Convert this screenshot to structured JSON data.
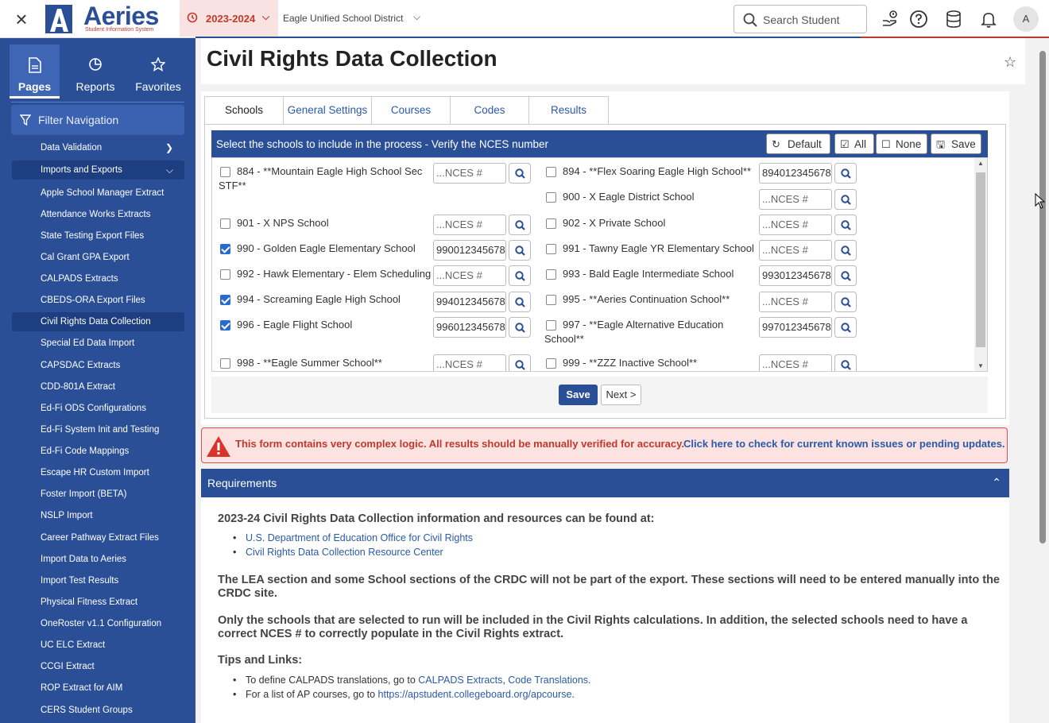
{
  "app": {
    "logo_text": "Aeries",
    "logo_subtitle": "Student Information System",
    "year": "2023-2024",
    "district": "Eagle Unified School District",
    "search_placeholder": "Search Student",
    "avatar_letter": "A"
  },
  "nav": {
    "tabs": [
      {
        "label": "Pages",
        "icon": "file-icon"
      },
      {
        "label": "Reports",
        "icon": "pie-chart-icon"
      },
      {
        "label": "Favorites",
        "icon": "star-icon"
      }
    ],
    "filter_label": "Filter Navigation",
    "items": [
      {
        "label": "Data Validation",
        "type": "group-collapsed"
      },
      {
        "label": "Imports and Exports",
        "type": "group-expanded"
      },
      {
        "label": "Apple School Manager Extract"
      },
      {
        "label": "Attendance Works Extracts"
      },
      {
        "label": "State Testing Export Files"
      },
      {
        "label": "Cal Grant GPA Export"
      },
      {
        "label": "CALPADS Extracts"
      },
      {
        "label": "CBEDS-ORA Export Files"
      },
      {
        "label": "Civil Rights Data Collection",
        "active": true
      },
      {
        "label": "Special Ed Data Import"
      },
      {
        "label": "CAPSDAC Extracts"
      },
      {
        "label": "CDD-801A Extract"
      },
      {
        "label": "Ed-Fi ODS Configurations"
      },
      {
        "label": "Ed-Fi System Init and Testing"
      },
      {
        "label": "Ed-Fi Code Mappings"
      },
      {
        "label": "Escape HR Custom Import"
      },
      {
        "label": "Foster Import (BETA)"
      },
      {
        "label": "NSLP Import"
      },
      {
        "label": "Career Pathway Extract Files"
      },
      {
        "label": "Import Data to Aeries"
      },
      {
        "label": "Import Test Results"
      },
      {
        "label": "Physical Fitness Extract"
      },
      {
        "label": "OneRoster v1.1 Configuration"
      },
      {
        "label": "UC ELC Extract"
      },
      {
        "label": "CCGI Extract"
      },
      {
        "label": "ROP Extract for AIM"
      },
      {
        "label": "CERS Student Groups"
      }
    ]
  },
  "page": {
    "title": "Civil Rights Data Collection",
    "tabs": [
      "Schools",
      "General Settings",
      "Courses",
      "Codes",
      "Results"
    ],
    "select_header": "Select the schools to include in the process - Verify the NCES number",
    "header_buttons": {
      "default": "Default",
      "all": "All",
      "none": "None",
      "save": "Save"
    },
    "nces_placeholder": "...NCES #",
    "schools_left": [
      {
        "name": "884 - **Mountain Eagle High School Sec",
        "name2": "STF**",
        "checked": false,
        "nces": ""
      },
      {
        "name": "901 - X NPS School",
        "checked": false,
        "nces": ""
      },
      {
        "name": "990 - Golden Eagle Elementary School",
        "checked": true,
        "nces": "990012345678"
      },
      {
        "name": "992 - Hawk Elementary - Elem Scheduling",
        "checked": false,
        "nces": ""
      },
      {
        "name": "994 - Screaming Eagle High School",
        "checked": true,
        "nces": "994012345678"
      },
      {
        "name": "996 - Eagle Flight School",
        "checked": true,
        "nces": "996012345678"
      },
      {
        "name": "998 - **Eagle Summer School**",
        "checked": false,
        "nces": ""
      }
    ],
    "schools_right": [
      {
        "name": "894 - **Flex Soaring Eagle High School**",
        "checked": false,
        "nces": "894012345678"
      },
      {
        "name": "900 - X Eagle District School",
        "checked": false,
        "nces": ""
      },
      {
        "name": "902 - X Private School",
        "checked": false,
        "nces": ""
      },
      {
        "name": "991 - Tawny Eagle YR Elementary School",
        "checked": false,
        "nces": ""
      },
      {
        "name": "993 - Bald Eagle Intermediate School",
        "checked": false,
        "nces": "993012345678"
      },
      {
        "name": "995 - **Aeries Continuation School**",
        "checked": false,
        "nces": ""
      },
      {
        "name": "997 - **Eagle Alternative Education",
        "name2": "School**",
        "checked": false,
        "nces": "997012345678"
      },
      {
        "name": "999 - **ZZZ Inactive School**",
        "checked": false,
        "nces": ""
      }
    ],
    "save_label": "Save",
    "next_label": "Next >",
    "warning_text": "This form contains very complex logic. All results should be manually verified for accuracy.",
    "warning_link": "Click here to check for current known issues or pending updates.",
    "requirements_title": "Requirements",
    "req": {
      "intro": "2023-24 Civil Rights Data Collection information and resources can be found at:",
      "link1": "U.S. Department of Education Office for Civil Rights",
      "link2": "Civil Rights Data Collection Resource Center",
      "p1a": "The LEA section and some School sections of the CRDC will not be part of the export. These sections will need to be entered manually into the",
      "p1b": "CRDC site.",
      "p2a": "Only the schools that are selected to run will be included in the Civil Rights calculations. In addition, the selected schools need to have a",
      "p2b": "correct NCES # to correctly populate in the Civil Rights extract.",
      "tips_title": "Tips and Links:",
      "tip1_text": "To define CALPADS translations, go to",
      "tip1_link1": "CALPADS Extracts",
      "tip1_link2": "Code Translations",
      "tip2_text": "For a list of AP courses, go to",
      "tip2_link": "https://apstudent.collegeboard.org/apcourse"
    }
  },
  "colors": {
    "primary": "#2a4f97",
    "accent": "#c0392b",
    "link": "#2a5aa8"
  }
}
